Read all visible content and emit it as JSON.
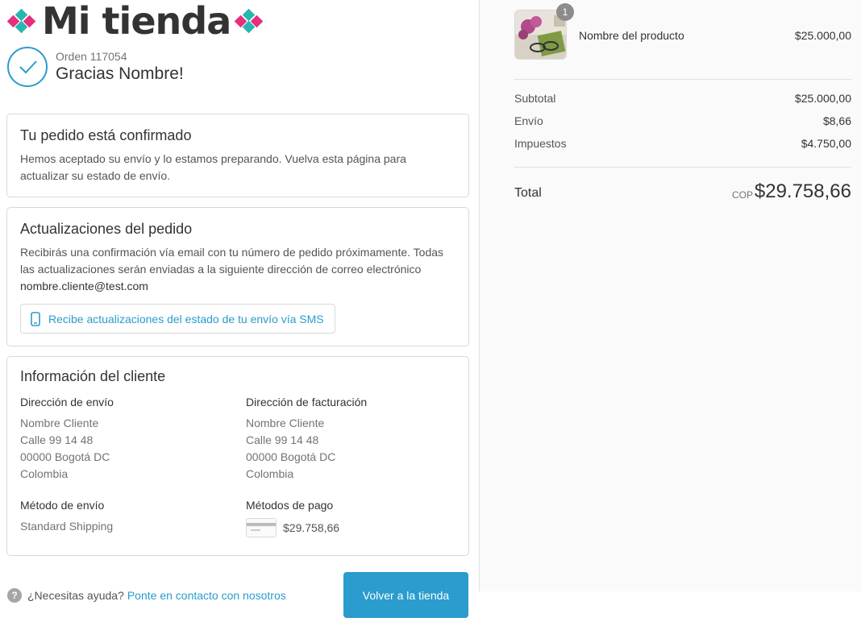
{
  "store": {
    "name": "Mi tienda"
  },
  "header": {
    "order_label": "Orden 117054",
    "thanks": "Gracias Nombre!"
  },
  "confirm": {
    "title": "Tu pedido está confirmado",
    "text": "Hemos aceptado su envío y lo estamos preparando. Vuelva esta página para actualizar su estado de envío."
  },
  "updates": {
    "title": "Actualizaciones del pedido",
    "text": "Recibirás una confirmación vía email con tu número de pedido próximamente. Todas las actualizaciones serán enviadas a la siguiente dirección de correo electrónico",
    "email": "nombre.cliente@test.com",
    "sms_label": "Recibe actualizaciones del estado de tu envío vía SMS"
  },
  "customer": {
    "title": "Información del cliente",
    "shipping_address": {
      "heading": "Dirección de envío",
      "lines": [
        "Nombre Cliente",
        "Calle 99 14 48",
        "00000 Bogotá DC",
        "Colombia"
      ]
    },
    "billing_address": {
      "heading": "Dirección de facturación",
      "lines": [
        "Nombre Cliente",
        "Calle 99 14 48",
        "00000 Bogotá DC",
        "Colombia"
      ]
    },
    "shipping_method": {
      "heading": "Método de envío",
      "value": "Standard Shipping"
    },
    "payment_method": {
      "heading": "Métodos de pago",
      "value": "$29.758,66"
    }
  },
  "footer": {
    "help_text": "¿Necesitas ayuda?",
    "help_link": "Ponte en contacto con nosotros",
    "back_button": "Volver a la tienda"
  },
  "summary": {
    "product": {
      "name": "Nombre del producto",
      "price": "$25.000,00",
      "quantity": "1"
    },
    "subtotal_label": "Subtotal",
    "subtotal": "$25.000,00",
    "shipping_label": "Envío",
    "shipping": "$8,66",
    "taxes_label": "Impuestos",
    "taxes": "$4.750,00",
    "total_label": "Total",
    "currency": "COP",
    "total": "$29.758,66"
  },
  "colors": {
    "accent": "#2a9ccd",
    "pink": "#e5307e",
    "teal": "#27b7b0"
  },
  "icons": [
    "check-icon",
    "phone-icon",
    "help-icon",
    "credit-card-icon"
  ]
}
